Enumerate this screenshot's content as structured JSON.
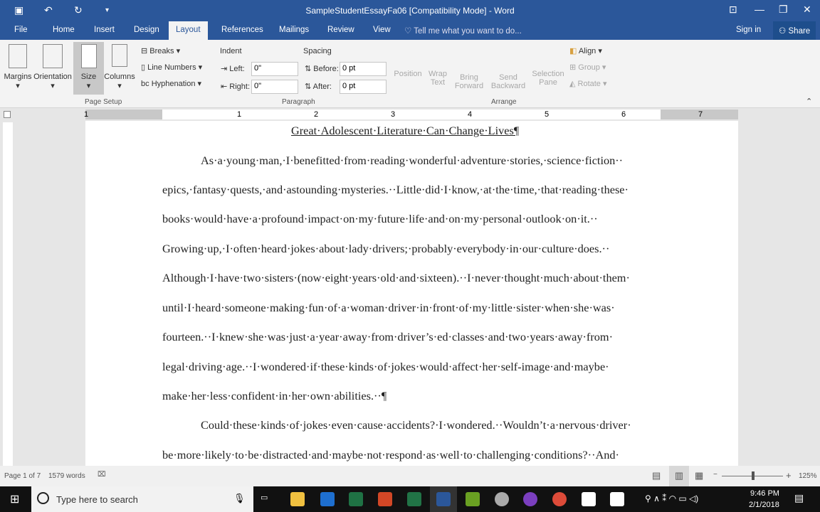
{
  "window": {
    "title": "SampleStudentEssayFa06 [Compatibility Mode] - Word"
  },
  "tabs": [
    "File",
    "Home",
    "Insert",
    "Design",
    "Layout",
    "References",
    "Mailings",
    "Review",
    "View"
  ],
  "tell_me": "Tell me what you want to do...",
  "sign_in": "Sign in",
  "share": "Share",
  "ribbon": {
    "margins": "Margins",
    "orientation": "Orientation",
    "size": "Size",
    "columns": "Columns",
    "breaks": "Breaks",
    "line_numbers": "Line Numbers",
    "hyphenation": "Hyphenation",
    "page_setup": "Page Setup",
    "indent": "Indent",
    "left": "Left:",
    "right": "Right:",
    "left_val": "0\"",
    "right_val": "0\"",
    "spacing": "Spacing",
    "before": "Before:",
    "after": "After:",
    "before_val": "0 pt",
    "after_val": "0 pt",
    "paragraph": "Paragraph",
    "position": "Position",
    "wrap1": "Wrap",
    "wrap2": "Text",
    "bring1": "Bring",
    "bring2": "Forward",
    "send1": "Send",
    "send2": "Backward",
    "sel1": "Selection",
    "sel2": "Pane",
    "align": "Align",
    "group": "Group",
    "rotate": "Rotate",
    "arrange": "Arrange"
  },
  "ruler_ticks": [
    "1",
    "1",
    "2",
    "3",
    "4",
    "5",
    "6",
    "7"
  ],
  "document": {
    "title": "Great·Adolescent·Literature·Can·Change·Lives¶",
    "lines": [
      "As·a·young·man,·I·benefitted·from·reading·wonderful·adventure·stories,·science·fiction··",
      "epics,·fantasy·quests,·and·astounding·mysteries.··Little·did·I·know,·at·the·time,·that·reading·these·",
      "books·would·have·a·profound·impact·on·my·future·life·and·on·my·personal·outlook·on·it.··",
      "Growing·up,·I·often·heard·jokes·about·lady·drivers;·probably·everybody·in·our·culture·does.··",
      "Although·I·have·two·sisters·(now·eight·years·old·and·sixteen).··I·never·thought·much·about·them·",
      "until·I·heard·someone·making·fun·of·a·woman·driver·in·front·of·my·little·sister·when·she·was·",
      "fourteen.··I·knew·she·was·just·a·year·away·from·driver’s·ed·classes·and·two·years·away·from·",
      "legal·driving·age.··I·wondered·if·these·kinds·of·jokes·would·affect·her·self-image·and·maybe·",
      "make·her·less·confident·in·her·own·abilities.··¶",
      "Could·these·kinds·of·jokes·even·cause·accidents?·I·wondered.··Wouldn’t·a·nervous·driver·",
      "be·more·likely·to·be·distracted·and·maybe·not·respond·as·well·to·challenging·conditions?··And·"
    ]
  },
  "status": {
    "page": "Page 1 of 7",
    "words": "1579 words",
    "zoom": "125%"
  },
  "taskbar": {
    "search": "Type here to search",
    "time": "9:46 PM",
    "date": "2/1/2018"
  }
}
